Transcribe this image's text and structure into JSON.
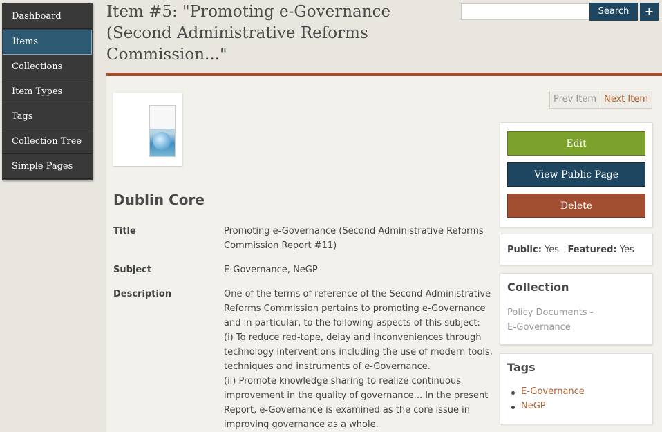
{
  "nav": {
    "items": [
      {
        "label": "Dashboard"
      },
      {
        "label": "Items",
        "active": true
      },
      {
        "label": "Collections"
      },
      {
        "label": "Item Types"
      },
      {
        "label": "Tags"
      },
      {
        "label": "Collection Tree"
      },
      {
        "label": "Simple Pages"
      }
    ]
  },
  "header": {
    "title": "Item #5: \"Promoting e-Governance (Second Administrative Reforms Commission...\"",
    "search_placeholder": "",
    "search_label": "Search",
    "advanced_label": "+"
  },
  "pager": {
    "prev": "Prev Item",
    "next": "Next Item"
  },
  "dublin_core": {
    "heading": "Dublin Core",
    "title_label": "Title",
    "title_value": "Promoting e-Governance (Second Administrative Reforms Commission Report #11)",
    "subject_label": "Subject",
    "subject_value": "E-Governance, NeGP",
    "description_label": "Description",
    "description_value": "One of the terms of reference of the Second Administrative Reforms Commission pertains to promoting e-Governance and in particular, to the following aspects of this subject:\n(i) To reduce red-tape, delay and inconveniences through technology interventions including the use of modern tools, techniques and instruments of e-Governance.\n(ii) Promote knowledge sharing to realize continuous improvement in the quality of governance... In the present Report, e-Governance is examined as the core issue in improving governance as a whole."
  },
  "actions": {
    "edit": "Edit",
    "view_public": "View Public Page",
    "delete": "Delete"
  },
  "status": {
    "public_label": "Public:",
    "public_value": "Yes",
    "featured_label": "Featured:",
    "featured_value": "Yes"
  },
  "collection": {
    "heading": "Collection",
    "value": "Policy Documents - E-Governance"
  },
  "tags": {
    "heading": "Tags",
    "items": [
      "E-Governance",
      "NeGP"
    ]
  },
  "colors": {
    "accent_rust": "#a24f31",
    "navy": "#1e4660",
    "green": "#7da22c",
    "link": "#b5602f"
  }
}
